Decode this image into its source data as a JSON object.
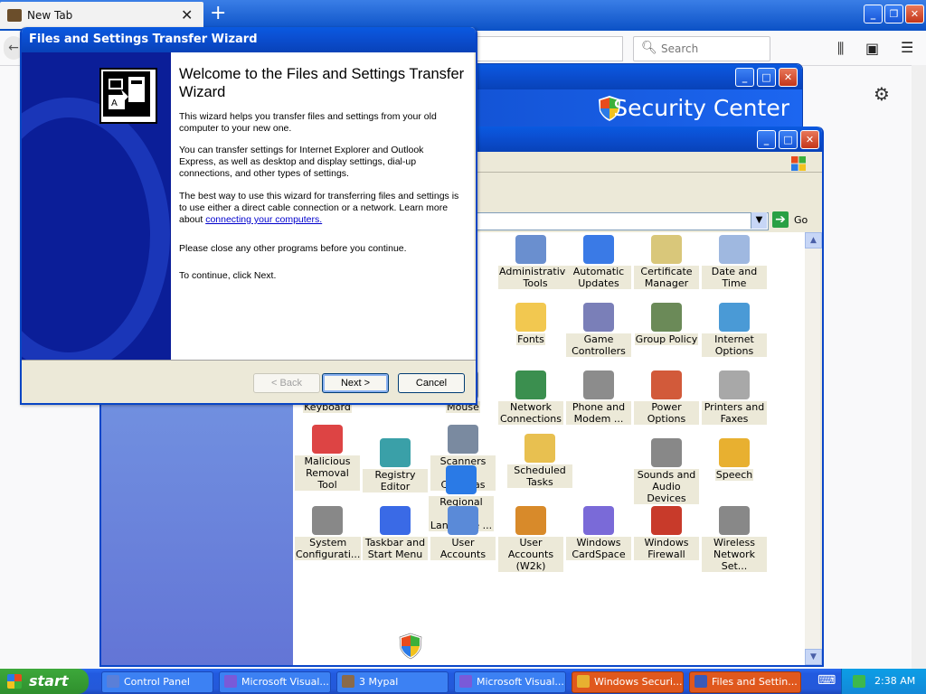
{
  "firefox": {
    "tab_title": "New Tab",
    "search_placeholder": "Search"
  },
  "security_center": {
    "title": "Security Center"
  },
  "control_panel": {
    "go_label": "Go",
    "items": [
      {
        "label": "",
        "icon": "partial-icon"
      },
      {
        "label": "Administrative Tools",
        "icon": "admin-tools-icon"
      },
      {
        "label": "Automatic Updates",
        "icon": "windows-update-icon"
      },
      {
        "label": "Certificate Manager",
        "icon": "certificate-icon"
      },
      {
        "label": "Date and Time",
        "icon": "clock-icon"
      },
      {
        "label": "",
        "icon": "partial-icon"
      },
      {
        "label": "Fonts",
        "icon": "fonts-folder-icon"
      },
      {
        "label": "Game Controllers",
        "icon": "gamepad-icon"
      },
      {
        "label": "Group Policy",
        "icon": "group-policy-icon"
      },
      {
        "label": "Internet Options",
        "icon": "globe-icon"
      },
      {
        "label": "Keyboard",
        "icon": "keyboard-icon"
      },
      {
        "label": "Mouse",
        "icon": "mouse-icon"
      },
      {
        "label": "Network Connections",
        "icon": "network-icon"
      },
      {
        "label": "Phone and Modem ...",
        "icon": "phone-icon"
      },
      {
        "label": "Power Options",
        "icon": "power-icon"
      },
      {
        "label": "Printers and Faxes",
        "icon": "printer-icon"
      },
      {
        "label": "Malicious Removal Tool",
        "icon": "mrt-icon"
      },
      {
        "label": "Registry Editor",
        "icon": "registry-icon"
      },
      {
        "label": "Scanners and Cameras",
        "icon": "scanner-icon"
      },
      {
        "label": "Scheduled Tasks",
        "icon": "scheduled-tasks-icon"
      },
      {
        "label": "Sounds and Audio Devices",
        "icon": "speaker-icon"
      },
      {
        "label": "Speech",
        "icon": "speech-icon"
      },
      {
        "label": "Regional and Language ...",
        "icon": "regional-icon"
      },
      {
        "label": "System Configurati...",
        "icon": "system-config-icon"
      },
      {
        "label": "Taskbar and Start Menu",
        "icon": "taskbar-icon"
      },
      {
        "label": "User Accounts",
        "icon": "users-icon"
      },
      {
        "label": "User Accounts (W2k)",
        "icon": "users-w2k-icon"
      },
      {
        "label": "Windows CardSpace",
        "icon": "cardspace-icon"
      },
      {
        "label": "Windows Firewall",
        "icon": "firewall-icon"
      },
      {
        "label": "Wireless Network Set...",
        "icon": "wireless-icon"
      }
    ]
  },
  "wizard": {
    "window_title": "Files and Settings Transfer Wizard",
    "heading": "Welcome to the Files and Settings Transfer Wizard",
    "p1": "This wizard helps you transfer files and settings from your old computer to your new one.",
    "p2": "You can transfer settings for Internet Explorer and Outlook Express, as well as desktop and display settings, dial-up connections, and other types of settings.",
    "p3_text": "The best way to use this wizard for transferring files and settings is to use either a direct cable connection or a network. Learn more about ",
    "p3_link": "connecting your computers.",
    "p4": "Please close any other programs before you continue.",
    "p5": "To continue, click Next.",
    "back_label": "< Back",
    "next_label": "Next >",
    "cancel_label": "Cancel"
  },
  "taskbar": {
    "start_label": "start",
    "tasks": [
      {
        "label": "Control Panel",
        "active": false
      },
      {
        "label": "Microsoft Visual...",
        "active": false
      },
      {
        "label": "3 Mypal",
        "active": false
      },
      {
        "label": "Microsoft Visual...",
        "active": false
      },
      {
        "label": "Windows Securi...",
        "active": true
      },
      {
        "label": "Files and Settin...",
        "active": true
      }
    ],
    "clock": "2:38 AM"
  },
  "colors": {
    "xp_title_blue": "#0a5ae0",
    "taskbar_blue": "#245edc",
    "start_green": "#3da83b",
    "wizard_side": "#0b1e98"
  }
}
